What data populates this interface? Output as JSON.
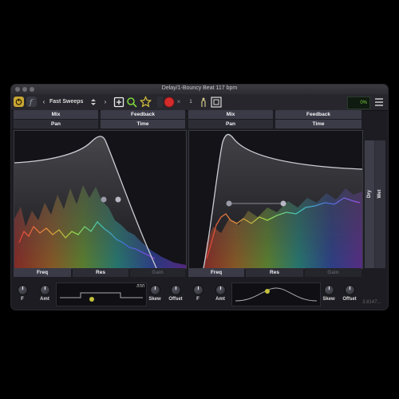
{
  "window": {
    "title": "Delay/1-Bouncy Beat 117 bpm"
  },
  "toolbar": {
    "preset_name": "Fast Sweeps",
    "prev_arrow": "‹",
    "next_arrow": "›",
    "add_icon": "plus-square-icon",
    "search_icon": "search-icon",
    "favorite_icon": "star-icon",
    "close_x": "×",
    "meter_value": "0%",
    "small_value": "1"
  },
  "left": {
    "mix_label": "Mix",
    "feedback_label": "Feedback",
    "pan_label": "Pan",
    "time_label": "Time",
    "freq_label": "Freq",
    "res_label": "Res",
    "gain_label": "Gain"
  },
  "right": {
    "mix_label": "Mix",
    "feedback_label": "Feedback",
    "pan_label": "Pan",
    "time_label": "Time",
    "freq_label": "Freq",
    "res_label": "Res",
    "gain_label": "Gain"
  },
  "mix_side": {
    "dry_label": "Dry",
    "wet_label": "Wet"
  },
  "bottom_left": {
    "f_label": "F",
    "amt_label": "Amt",
    "skew_label": "Skew",
    "offset_label": "Offset",
    "wave_badge": "ЛЛЛ"
  },
  "bottom_right": {
    "f_label": "F",
    "amt_label": "Amt",
    "skew_label": "Skew",
    "offset_label": "Offset",
    "version": "3.8147..."
  }
}
